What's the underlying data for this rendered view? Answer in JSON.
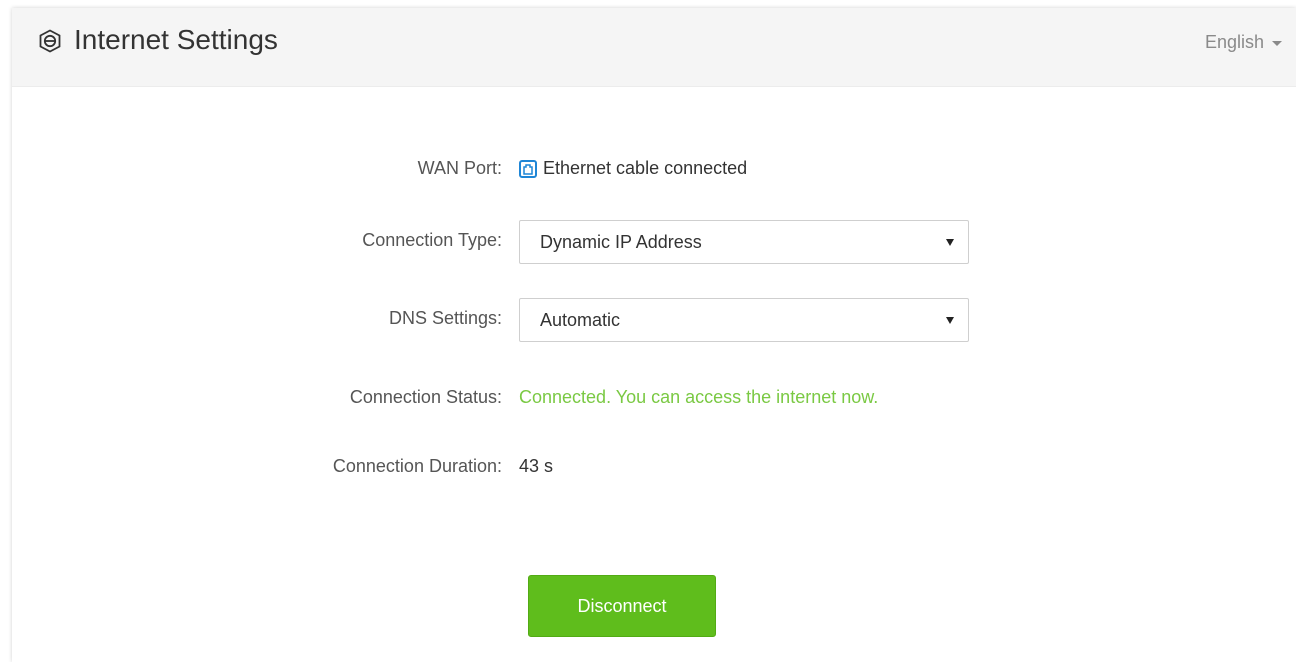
{
  "header": {
    "title": "Internet Settings",
    "language": "English",
    "icon": "internet-globe-icon"
  },
  "form": {
    "wan_port": {
      "label": "WAN Port:",
      "value": "Ethernet cable connected",
      "icon": "ethernet-port-icon"
    },
    "connection_type": {
      "label": "Connection Type:",
      "selected": "Dynamic IP Address"
    },
    "dns_settings": {
      "label": "DNS Settings:",
      "selected": "Automatic"
    },
    "connection_status": {
      "label": "Connection Status:",
      "value": "Connected. You can access the internet now.",
      "color": "#7ac943"
    },
    "connection_duration": {
      "label": "Connection Duration:",
      "value": "43 s"
    }
  },
  "actions": {
    "disconnect_label": "Disconnect",
    "button_color": "#5fbd1c"
  }
}
